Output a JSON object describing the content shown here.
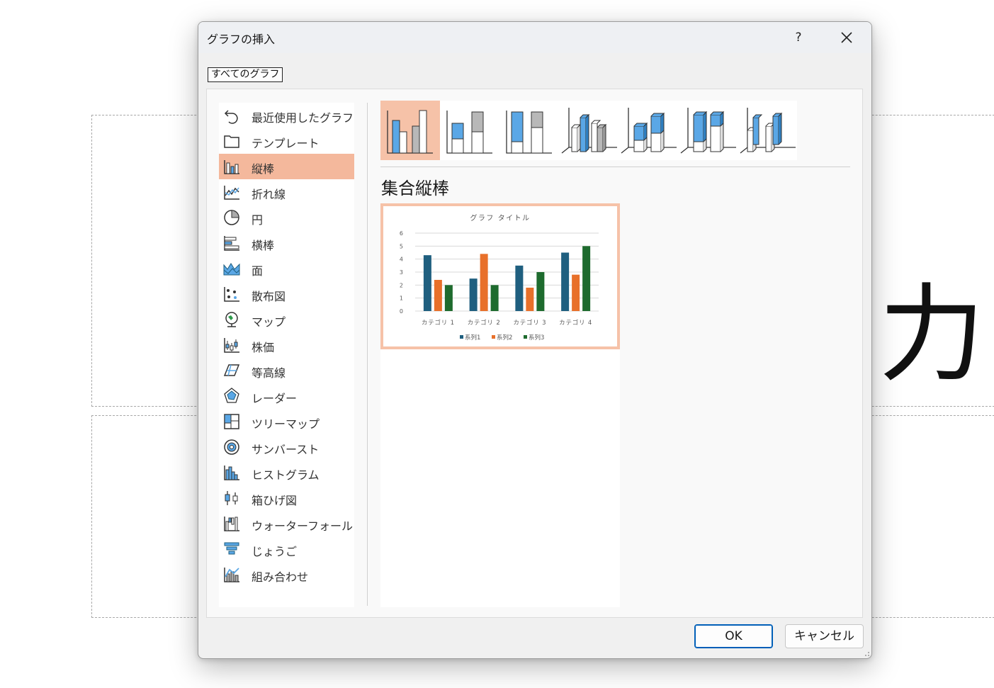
{
  "background": {
    "glyph": "力"
  },
  "dialog": {
    "title": "グラフの挿入",
    "help": "?",
    "close": "✕",
    "tab_label": "すべてのグラフ",
    "selected_subtype_title": "集合縦棒",
    "ok_label": "OK",
    "cancel_label": "キャンセル"
  },
  "sidebar": {
    "items": [
      {
        "label": "最近使用したグラフ",
        "icon": "recent-icon"
      },
      {
        "label": "テンプレート",
        "icon": "template-folder-icon"
      },
      {
        "label": "縦棒",
        "icon": "column-chart-icon",
        "selected": true
      },
      {
        "label": "折れ線",
        "icon": "line-chart-icon"
      },
      {
        "label": "円",
        "icon": "pie-chart-icon"
      },
      {
        "label": "横棒",
        "icon": "bar-chart-icon"
      },
      {
        "label": "面",
        "icon": "area-chart-icon"
      },
      {
        "label": "散布図",
        "icon": "scatter-chart-icon"
      },
      {
        "label": "マップ",
        "icon": "map-chart-icon"
      },
      {
        "label": "株価",
        "icon": "stock-chart-icon"
      },
      {
        "label": "等高線",
        "icon": "surface-chart-icon"
      },
      {
        "label": "レーダー",
        "icon": "radar-chart-icon"
      },
      {
        "label": "ツリーマップ",
        "icon": "treemap-chart-icon"
      },
      {
        "label": "サンバースト",
        "icon": "sunburst-chart-icon"
      },
      {
        "label": "ヒストグラム",
        "icon": "histogram-chart-icon"
      },
      {
        "label": "箱ひげ図",
        "icon": "box-whisker-chart-icon"
      },
      {
        "label": "ウォーターフォール",
        "icon": "waterfall-chart-icon"
      },
      {
        "label": "じょうご",
        "icon": "funnel-chart-icon"
      },
      {
        "label": "組み合わせ",
        "icon": "combo-chart-icon"
      }
    ]
  },
  "subtypes": [
    {
      "icon": "clustered-column-icon",
      "selected": true
    },
    {
      "icon": "stacked-column-icon"
    },
    {
      "icon": "100-stacked-column-icon"
    },
    {
      "icon": "3d-clustered-column-icon"
    },
    {
      "icon": "3d-stacked-column-icon"
    },
    {
      "icon": "3d-100-stacked-column-icon"
    },
    {
      "icon": "3d-column-icon"
    }
  ],
  "colors": {
    "accent_selected": "#f4b89c",
    "series1": "#1f5f7f",
    "series2": "#e8702a",
    "series3": "#1e6b2e",
    "icon_blue": "#5aa7e6"
  },
  "chart_data": {
    "type": "bar",
    "title": "グラフ タイトル",
    "categories": [
      "カテゴリ 1",
      "カテゴリ 2",
      "カテゴリ 3",
      "カテゴリ 4"
    ],
    "series": [
      {
        "name": "系列1",
        "values": [
          4.3,
          2.5,
          3.5,
          4.5
        ]
      },
      {
        "name": "系列2",
        "values": [
          2.4,
          4.4,
          1.8,
          2.8
        ]
      },
      {
        "name": "系列3",
        "values": [
          2,
          2,
          3,
          5
        ]
      }
    ],
    "yticks": [
      "0",
      "1",
      "2",
      "3",
      "4",
      "5",
      "6"
    ],
    "ylim": [
      0,
      6
    ],
    "grid": true,
    "legend": "bottom"
  }
}
